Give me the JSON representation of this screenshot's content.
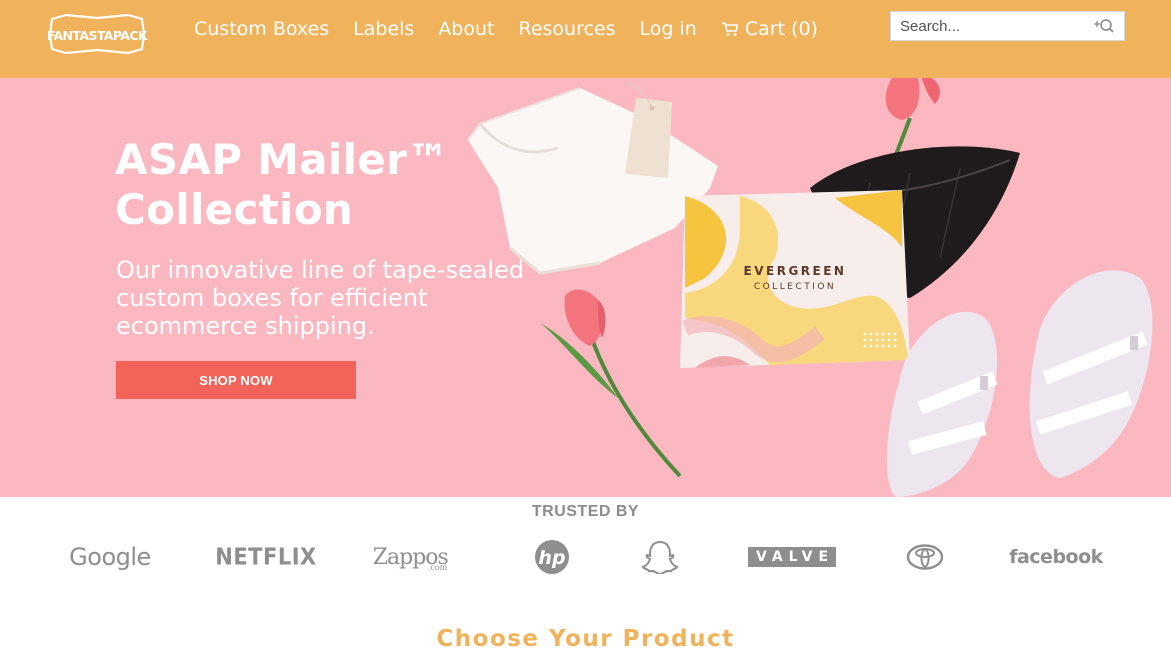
{
  "brand": {
    "logo_text": "FANTASTAPACK"
  },
  "nav": {
    "items": [
      {
        "label": "Custom Boxes"
      },
      {
        "label": "Labels"
      },
      {
        "label": "About"
      },
      {
        "label": "Resources"
      },
      {
        "label": "Log in"
      }
    ],
    "cart_label": "Cart (0)"
  },
  "search": {
    "placeholder": "Search..."
  },
  "hero": {
    "title": "ASAP Mailer™ Collection",
    "subtitle": "Our innovative line of tape-sealed custom boxes for efficient ecommerce shipping.",
    "button_label": "SHOP NOW",
    "box_title": "EVERGREEN",
    "box_subtitle": "COLLECTION"
  },
  "trusted": {
    "title": "TRUSTED BY",
    "logos": {
      "google": "Google",
      "netflix": "NETFLIX",
      "zappos": "Zappos",
      "zappos_suffix": ".com",
      "hp": "hp",
      "valve": "VALVE",
      "facebook": "facebook"
    }
  },
  "section": {
    "choose_title": "Choose Your Product"
  },
  "colors": {
    "header": "#f0b25b",
    "hero_bg": "#fbb8c1",
    "cta": "#f26359",
    "logo_gray": "#8e8e8e"
  },
  "icons": [
    "cart-icon",
    "search-icon",
    "snapchat-icon",
    "toyota-icon"
  ]
}
